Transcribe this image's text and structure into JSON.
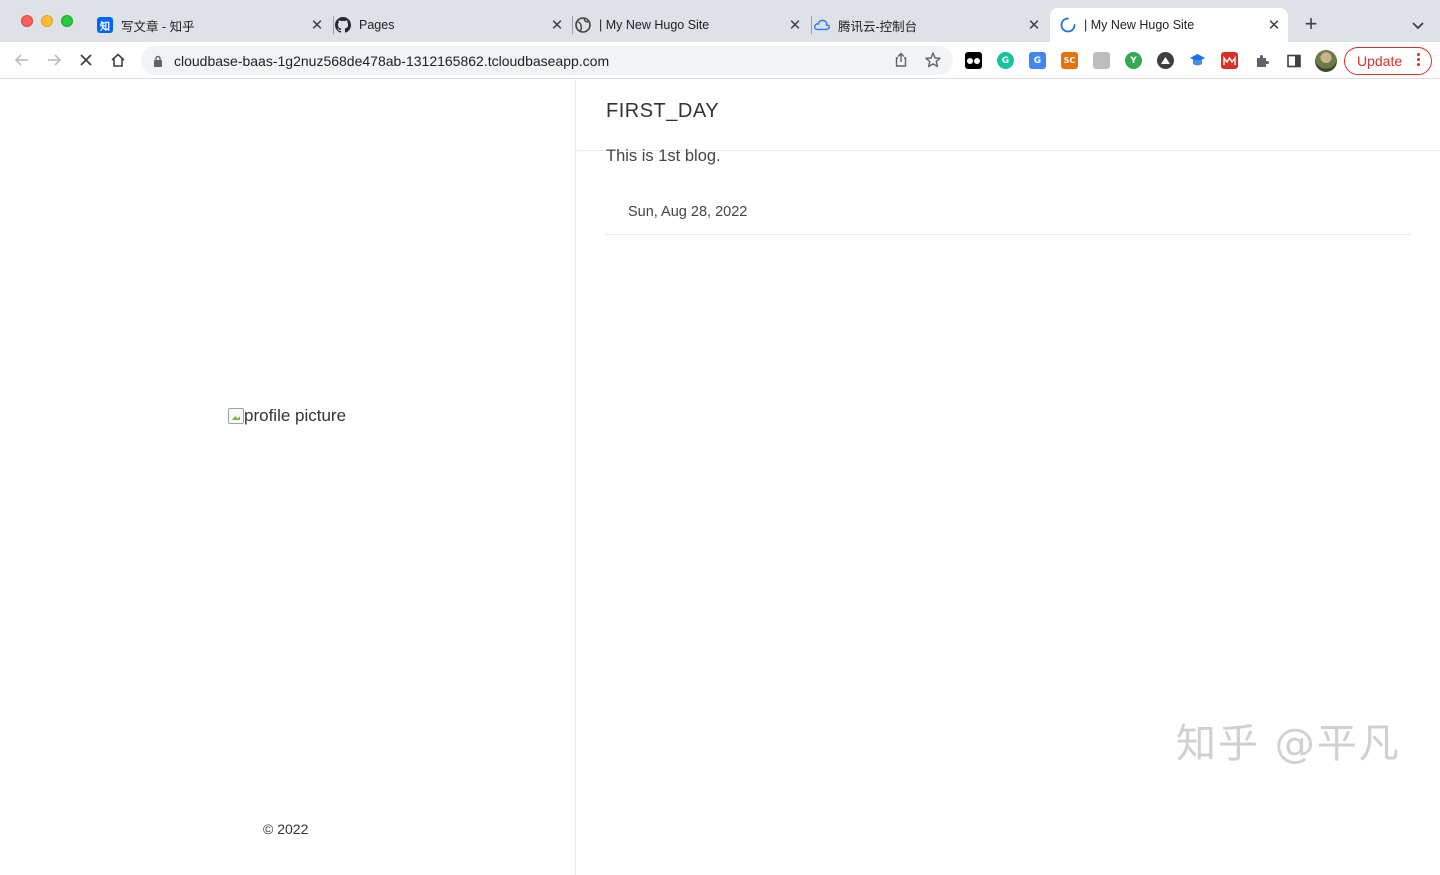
{
  "browser": {
    "tabs": [
      {
        "title": "写文章 - 知乎",
        "favicon": "zhihu-icon",
        "favicon_text": "知",
        "active": false
      },
      {
        "title": "Pages",
        "favicon": "github-icon",
        "active": false
      },
      {
        "title": "| My New Hugo Site",
        "favicon": "globe-icon",
        "active": false
      },
      {
        "title": "腾讯云-控制台",
        "favicon": "tencent-cloud-icon",
        "active": false
      },
      {
        "title": "| My New Hugo Site",
        "favicon": "loading-spinner-icon",
        "active": true
      }
    ],
    "new_tab_symbol": "+",
    "url": "cloudbase-baas-1g2nuz568de478ab-1312165862.tcloudbaseapp.com",
    "update_label": "Update",
    "extensions": [
      {
        "name": "tampermonkey-icon",
        "text": "",
        "color": "#000000"
      },
      {
        "name": "grammarly-icon",
        "text": "G",
        "color": "#15c39a"
      },
      {
        "name": "google-translate-icon",
        "text": "G",
        "color": "#4285f4"
      },
      {
        "name": "sc-extension-icon",
        "text": "SC",
        "color": "#e8710a"
      },
      {
        "name": "gray-extension-icon",
        "text": "",
        "color": "#bdbdbd"
      },
      {
        "name": "green-y-extension-icon",
        "text": "Y",
        "color": "#34a853"
      },
      {
        "name": "dark-circle-extension-icon",
        "text": "",
        "color": "#3c4043"
      },
      {
        "name": "blue-cap-extension-icon",
        "text": "",
        "color": "#1a73e8"
      },
      {
        "name": "red-extension-icon",
        "text": "",
        "color": "#d93025"
      },
      {
        "name": "puzzle-icon",
        "text": "",
        "color": "#5f6368"
      },
      {
        "name": "side-panel-icon",
        "text": "",
        "color": "#3c4043"
      }
    ]
  },
  "sidebar": {
    "profile_alt": "profile picture",
    "copyright": "© 2022"
  },
  "post": {
    "title": "FIRST_DAY",
    "summary": "This is 1st blog.",
    "date": "Sun, Aug 28, 2022"
  },
  "watermark": "知乎 @平凡"
}
